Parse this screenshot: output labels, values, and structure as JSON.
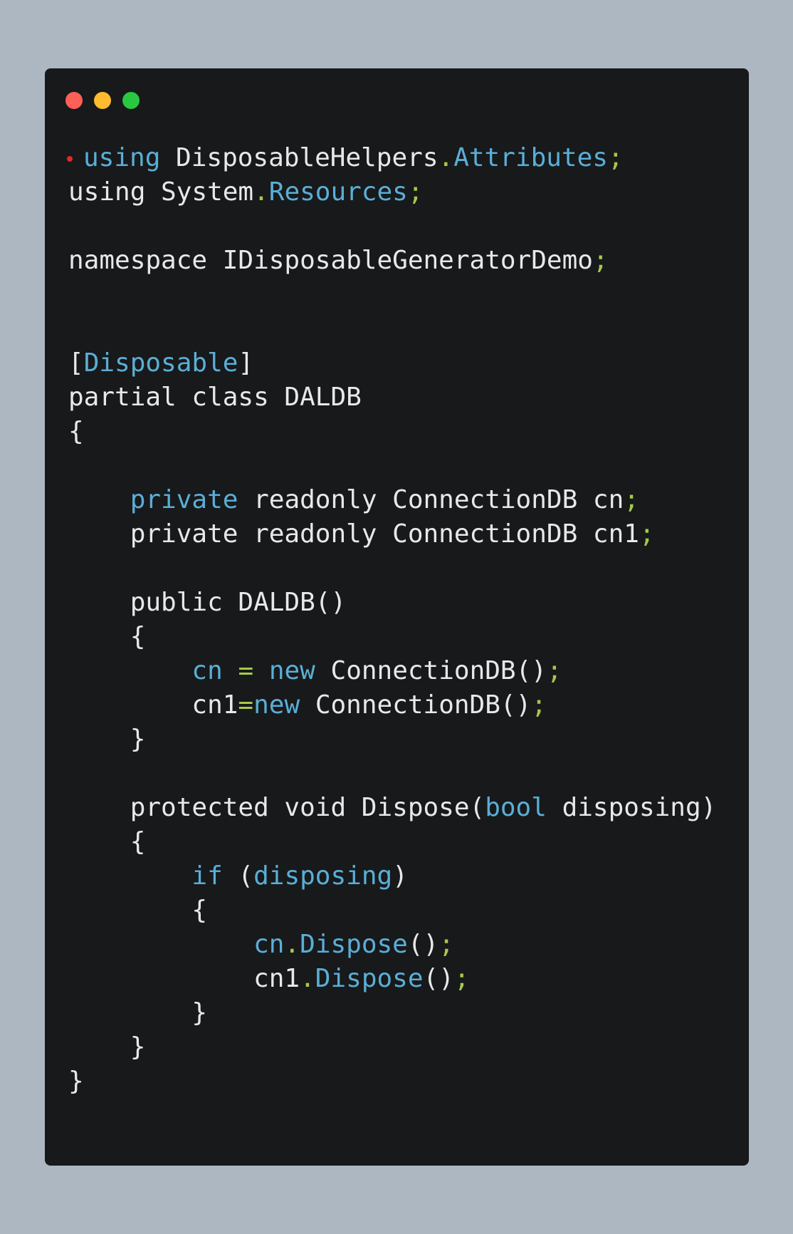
{
  "window": {
    "controls": [
      {
        "name": "close",
        "color": "#fe5f57"
      },
      {
        "name": "minimize",
        "color": "#febb2e"
      },
      {
        "name": "maximize",
        "color": "#29c840"
      }
    ]
  },
  "colors": {
    "background": "#adb7c1",
    "editor": "#17191b",
    "text": "#e8e8e8",
    "keyword": "#5aaed6",
    "punctuation": "#a8c84a",
    "marker": "#e02b2b"
  },
  "code": {
    "lines": [
      [
        {
          "t": "using",
          "c": "kw"
        },
        {
          "t": " DisposableHelpers",
          "c": "plain"
        },
        {
          "t": ".",
          "c": "punct"
        },
        {
          "t": "Attributes",
          "c": "id"
        },
        {
          "t": ";",
          "c": "punct"
        }
      ],
      [
        {
          "t": "using System",
          "c": "plain"
        },
        {
          "t": ".",
          "c": "punct"
        },
        {
          "t": "Resources",
          "c": "id"
        },
        {
          "t": ";",
          "c": "punct"
        }
      ],
      [],
      [
        {
          "t": "namespace IDisposableGeneratorDemo",
          "c": "plain"
        },
        {
          "t": ";",
          "c": "punct"
        }
      ],
      [],
      [],
      [
        {
          "t": "[",
          "c": "plain"
        },
        {
          "t": "Disposable",
          "c": "id"
        },
        {
          "t": "]",
          "c": "plain"
        }
      ],
      [
        {
          "t": "partial class DALDB",
          "c": "plain"
        }
      ],
      [
        {
          "t": "{",
          "c": "plain"
        }
      ],
      [],
      [
        {
          "t": "    ",
          "c": "plain"
        },
        {
          "t": "private",
          "c": "kw"
        },
        {
          "t": " readonly ConnectionDB cn",
          "c": "plain"
        },
        {
          "t": ";",
          "c": "punct"
        }
      ],
      [
        {
          "t": "    private readonly ConnectionDB cn1",
          "c": "plain"
        },
        {
          "t": ";",
          "c": "punct"
        }
      ],
      [],
      [
        {
          "t": "    public DALDB()",
          "c": "plain"
        }
      ],
      [
        {
          "t": "    {",
          "c": "plain"
        }
      ],
      [
        {
          "t": "        ",
          "c": "plain"
        },
        {
          "t": "cn",
          "c": "id"
        },
        {
          "t": " ",
          "c": "plain"
        },
        {
          "t": "=",
          "c": "punct"
        },
        {
          "t": " ",
          "c": "plain"
        },
        {
          "t": "new",
          "c": "kw"
        },
        {
          "t": " ConnectionDB()",
          "c": "plain"
        },
        {
          "t": ";",
          "c": "punct"
        }
      ],
      [
        {
          "t": "        cn1",
          "c": "plain"
        },
        {
          "t": "=",
          "c": "punct"
        },
        {
          "t": "new",
          "c": "kw"
        },
        {
          "t": " ConnectionDB()",
          "c": "plain"
        },
        {
          "t": ";",
          "c": "punct"
        }
      ],
      [
        {
          "t": "    }",
          "c": "plain"
        }
      ],
      [],
      [
        {
          "t": "    protected void Dispose(",
          "c": "plain"
        },
        {
          "t": "bool",
          "c": "kw"
        },
        {
          "t": " disposing)",
          "c": "plain"
        }
      ],
      [
        {
          "t": "    {",
          "c": "plain"
        }
      ],
      [
        {
          "t": "        ",
          "c": "plain"
        },
        {
          "t": "if",
          "c": "kw"
        },
        {
          "t": " (",
          "c": "plain"
        },
        {
          "t": "disposing",
          "c": "id"
        },
        {
          "t": ")",
          "c": "plain"
        }
      ],
      [
        {
          "t": "        {",
          "c": "plain"
        }
      ],
      [
        {
          "t": "            ",
          "c": "plain"
        },
        {
          "t": "cn",
          "c": "id"
        },
        {
          "t": ".",
          "c": "punct"
        },
        {
          "t": "Dispose",
          "c": "id"
        },
        {
          "t": "()",
          "c": "plain"
        },
        {
          "t": ";",
          "c": "punct"
        }
      ],
      [
        {
          "t": "            cn1",
          "c": "plain"
        },
        {
          "t": ".",
          "c": "punct"
        },
        {
          "t": "Dispose",
          "c": "id"
        },
        {
          "t": "()",
          "c": "plain"
        },
        {
          "t": ";",
          "c": "punct"
        }
      ],
      [
        {
          "t": "        }",
          "c": "plain"
        }
      ],
      [
        {
          "t": "    }",
          "c": "plain"
        }
      ],
      [
        {
          "t": "}",
          "c": "plain"
        }
      ]
    ]
  }
}
